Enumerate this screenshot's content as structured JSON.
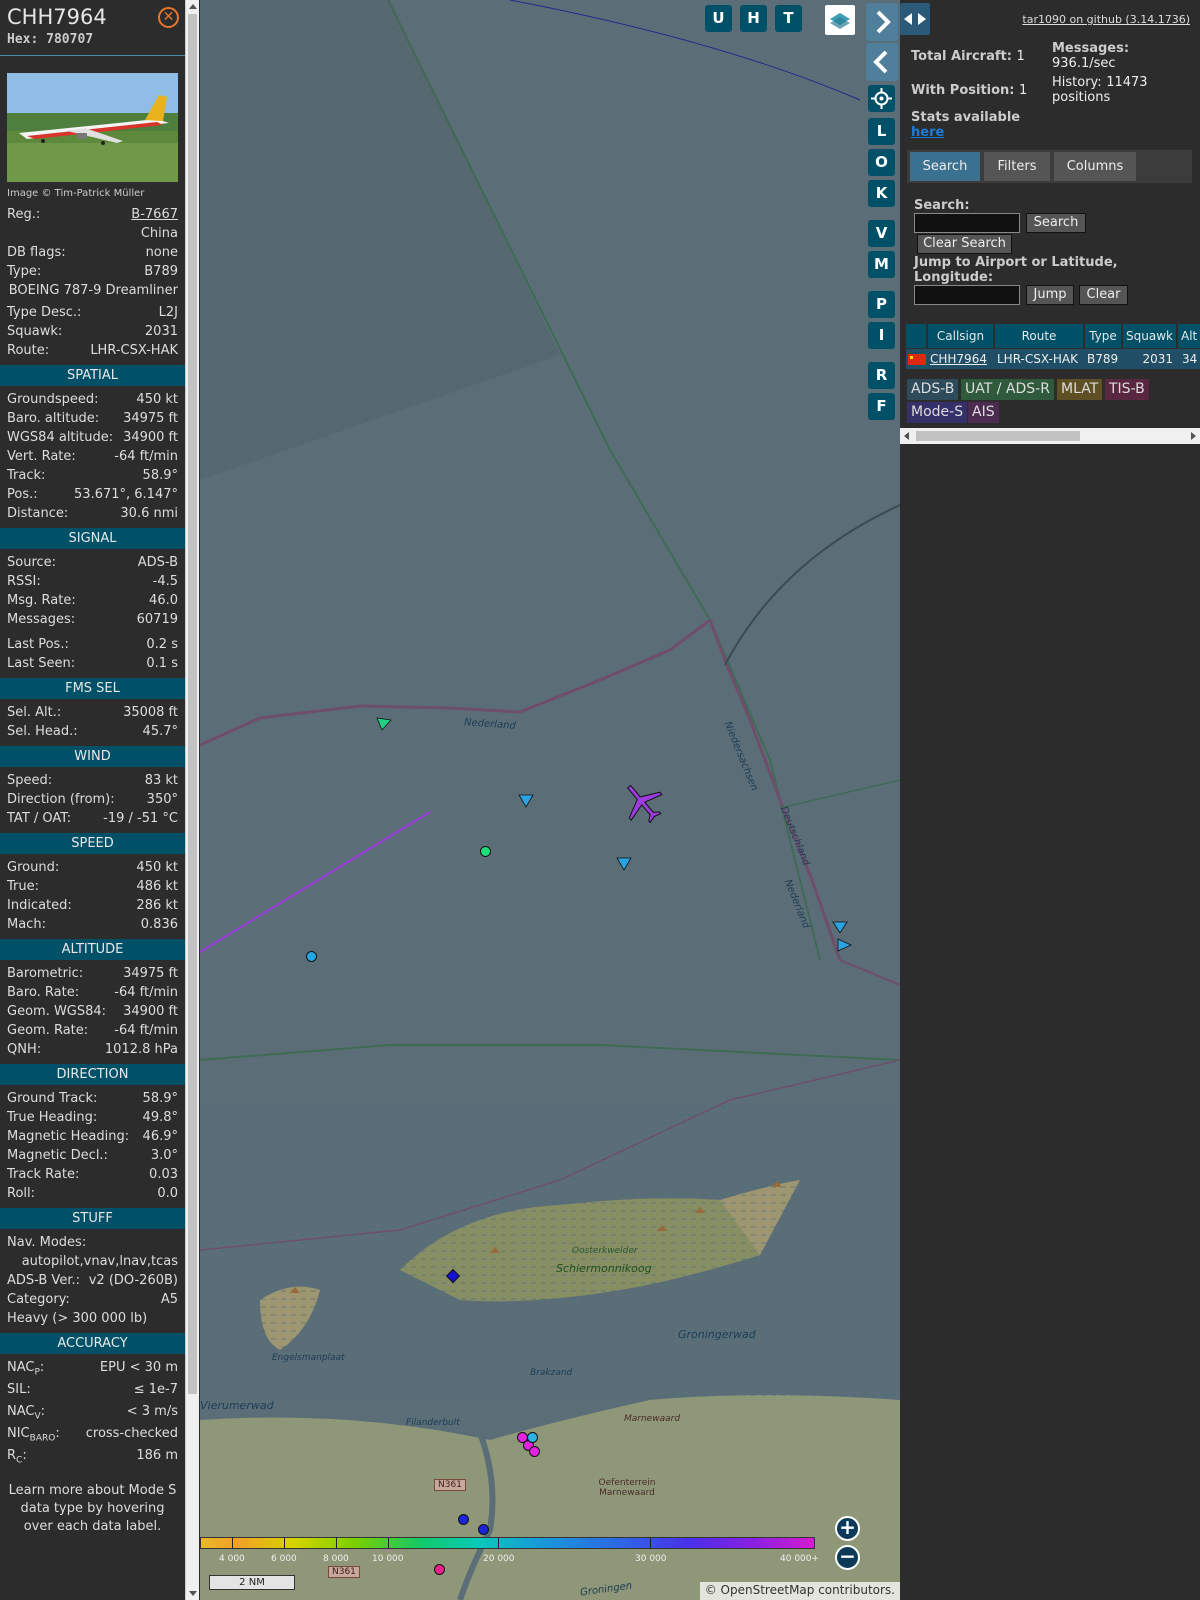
{
  "info": {
    "callsign": "CHH7964",
    "hex_label": "Hex:",
    "hex": "780707",
    "photo_credit": "Image © Tim-Patrick Müller",
    "reg_label": "Reg.:",
    "reg": "B-7667",
    "country": "China",
    "db_flags_label": "DB flags:",
    "db_flags": "none",
    "type_label": "Type:",
    "type": "B789",
    "type_full": "BOEING 787-9 Dreamliner",
    "type_desc_label": "Type Desc.:",
    "type_desc": "L2J",
    "squawk_label": "Squawk:",
    "squawk": "2031",
    "route_label": "Route:",
    "route": "LHR-CSX-HAK",
    "sections": {
      "spatial": "SPATIAL",
      "signal": "SIGNAL",
      "fms": "FMS SEL",
      "wind": "WIND",
      "speed": "SPEED",
      "altitude": "ALTITUDE",
      "direction": "DIRECTION",
      "stuff": "STUFF",
      "accuracy": "ACCURACY"
    },
    "spatial": [
      {
        "k": "Groundspeed:",
        "v": "450 kt"
      },
      {
        "k": "Baro. altitude:",
        "v": "34975 ft"
      },
      {
        "k": "WGS84 altitude:",
        "v": "34900 ft"
      },
      {
        "k": "Vert. Rate:",
        "v": "-64 ft/min"
      },
      {
        "k": "Track:",
        "v": "58.9°"
      },
      {
        "k": "Pos.:",
        "v": "53.671°, 6.147°"
      },
      {
        "k": "Distance:",
        "v": "30.6 nmi"
      }
    ],
    "signal": [
      {
        "k": "Source:",
        "v": "ADS-B"
      },
      {
        "k": "RSSI:",
        "v": "-4.5"
      },
      {
        "k": "Msg. Rate:",
        "v": "46.0"
      },
      {
        "k": "Messages:",
        "v": "60719"
      },
      {
        "k": "Last Pos.:",
        "v": "0.2 s"
      },
      {
        "k": "Last Seen:",
        "v": "0.1 s"
      }
    ],
    "fms": [
      {
        "k": "Sel. Alt.:",
        "v": "35008 ft"
      },
      {
        "k": "Sel. Head.:",
        "v": "45.7°"
      }
    ],
    "wind": [
      {
        "k": "Speed:",
        "v": "83 kt"
      },
      {
        "k": "Direction (from):",
        "v": "350°"
      },
      {
        "k": "TAT / OAT:",
        "v": "-19 / -51 °C"
      }
    ],
    "speed": [
      {
        "k": "Ground:",
        "v": "450 kt"
      },
      {
        "k": "True:",
        "v": "486 kt"
      },
      {
        "k": "Indicated:",
        "v": "286 kt"
      },
      {
        "k": "Mach:",
        "v": "0.836"
      }
    ],
    "altitude": [
      {
        "k": "Barometric:",
        "v": "34975 ft"
      },
      {
        "k": "Baro. Rate:",
        "v": "-64 ft/min"
      },
      {
        "k": "Geom. WGS84:",
        "v": "34900 ft"
      },
      {
        "k": "Geom. Rate:",
        "v": "-64 ft/min"
      },
      {
        "k": "QNH:",
        "v": "1012.8 hPa"
      }
    ],
    "direction": [
      {
        "k": "Ground Track:",
        "v": "58.9°"
      },
      {
        "k": "True Heading:",
        "v": "49.8°"
      },
      {
        "k": "Magnetic Heading:",
        "v": "46.9°"
      },
      {
        "k": "Magnetic Decl.:",
        "v": "3.0°"
      },
      {
        "k": "Track Rate:",
        "v": "0.03"
      },
      {
        "k": "Roll:",
        "v": "0.0"
      }
    ],
    "stuff": {
      "nav_label": "Nav. Modes:",
      "nav": "autopilot,vnav,lnav,tcas",
      "adsb_label": "ADS-B Ver.:",
      "adsb": "v2 (DO-260B)",
      "cat_label": "Category:",
      "cat": "A5",
      "heavy": "Heavy (> 300 000 lb)"
    },
    "accuracy": {
      "nacp_label": "NAC",
      "nacp_sub": "P",
      "nacp": "EPU < 30 m",
      "sil_label": "SIL:",
      "sil": "≤ 1e-7",
      "nacv_label": "NAC",
      "nacv_sub": "V",
      "nacv": "< 3 m/s",
      "nicbaro_label": "NIC",
      "nicbaro_sub": "BARO",
      "nicbaro": "cross-checked",
      "rc_label": "R",
      "rc_sub": "C",
      "rc": "186 m"
    },
    "note": "Learn more about Mode S data type by hovering over each data label."
  },
  "map": {
    "buttons": [
      "U",
      "H",
      "T"
    ],
    "side_buttons": [
      "L",
      "O",
      "K",
      "V",
      "M",
      "P",
      "I",
      "R",
      "F"
    ],
    "legend_labels": [
      "4 000",
      "6 000",
      "8 000",
      "10 000",
      "20 000",
      "30 000",
      "40 000+"
    ],
    "scale": "2 NM",
    "attribution": "© OpenStreetMap contributors.",
    "place_labels": [
      "Nederland",
      "Niedersachsen",
      "Deutschland",
      "Nederland",
      "Schiermonnikoog",
      "Oosterkwelder",
      "Groningerwad",
      "Engelsmanplaat",
      "Vierumerwad",
      "Brakzand",
      "Filanderbult",
      "Marnewaard",
      "Oefenterrein Marnewaard",
      "N361",
      "N361",
      "Groningen"
    ],
    "colors": {
      "track": "#9b3be0",
      "water": "#5b6e78"
    }
  },
  "right": {
    "github_link": "tar1090 on github (3.14.1736)",
    "total_label": "Total Aircraft:",
    "total": "1",
    "pos_label": "With Position:",
    "pos": "1",
    "messages_label": "Messages:",
    "messages": "936.1/sec",
    "history_label": "History:",
    "history": "11473 positions",
    "stats_label": "Stats available",
    "stats_link": "here",
    "tabs": [
      "Search",
      "Filters",
      "Columns"
    ],
    "search_label": "Search:",
    "search_button": "Search",
    "clear_search": "Clear Search",
    "jump_label": "Jump to Airport or Latitude, Longitude:",
    "jump_button": "Jump",
    "clear_button": "Clear",
    "table_headers": [
      "Callsign",
      "Route",
      "Type",
      "Squawk",
      "Alt"
    ],
    "row": {
      "callsign": "CHH7964",
      "route": "LHR-CSX-HAK",
      "type": "B789",
      "squawk": "2031",
      "alt": "34"
    },
    "sources": [
      "ADS-B",
      "UAT / ADS-R",
      "MLAT",
      "TIS-B",
      "Mode-S",
      "AIS"
    ]
  }
}
